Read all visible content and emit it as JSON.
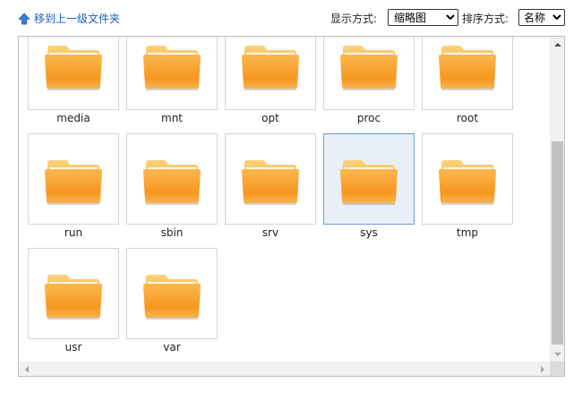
{
  "toolbar": {
    "up_label": "移到上一级文件夹",
    "view_label": "显示方式:",
    "view_selected": "缩略图",
    "sort_label": "排序方式:",
    "sort_selected": "名称"
  },
  "colors": {
    "link": "#1a5fb4",
    "folder_top": "#f9b24a",
    "folder_bottom": "#f7951e",
    "selected_bg": "#e9eff7",
    "selected_border": "#6b9fd6"
  },
  "icons": {
    "up": "up-arrow-icon",
    "folder": "folder-icon"
  },
  "folders": [
    {
      "name": "media",
      "selected": false
    },
    {
      "name": "mnt",
      "selected": false
    },
    {
      "name": "opt",
      "selected": false
    },
    {
      "name": "proc",
      "selected": false
    },
    {
      "name": "root",
      "selected": false
    },
    {
      "name": "run",
      "selected": false
    },
    {
      "name": "sbin",
      "selected": false
    },
    {
      "name": "srv",
      "selected": false
    },
    {
      "name": "sys",
      "selected": true
    },
    {
      "name": "tmp",
      "selected": false
    },
    {
      "name": "usr",
      "selected": false
    },
    {
      "name": "var",
      "selected": false
    }
  ]
}
